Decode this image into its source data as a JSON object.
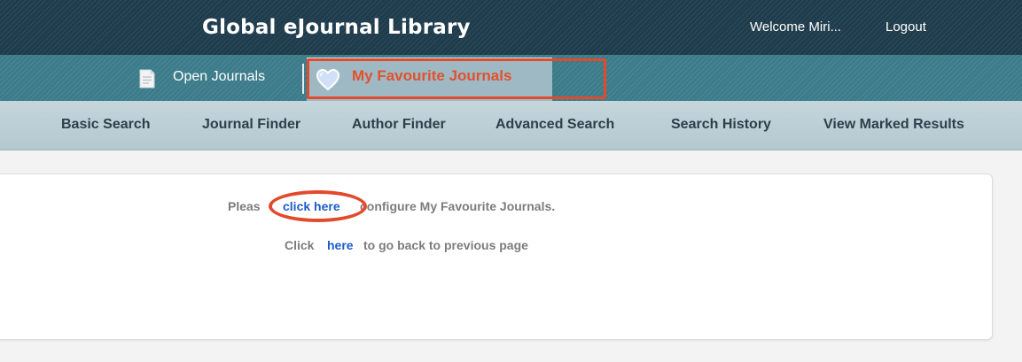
{
  "header": {
    "title": "Global eJournal Library",
    "welcome": "Welcome  Miri...",
    "logout": "Logout"
  },
  "tabs": {
    "open_journals": "Open Journals",
    "favourite": "My Favourite Journals"
  },
  "nav": {
    "items": [
      "Basic Search",
      "Journal Finder",
      "Author Finder",
      "Advanced Search",
      "Search History",
      "View Marked Results"
    ]
  },
  "content": {
    "line1_before": "Pleas",
    "line1_link": "click here",
    "line1_after": "configure My Favourite Journals.",
    "line2_before": "Click",
    "line2_link": "here",
    "line2_after": "to go back to previous page"
  },
  "colors": {
    "header_bg": "#1f3c4c",
    "tabbar_bg": "#3b7b8a",
    "active_tab_text": "#e2512e",
    "annotation": "#e24a2c",
    "link": "#1d5cc8"
  },
  "icons": [
    "document-icon",
    "heart-icon"
  ]
}
